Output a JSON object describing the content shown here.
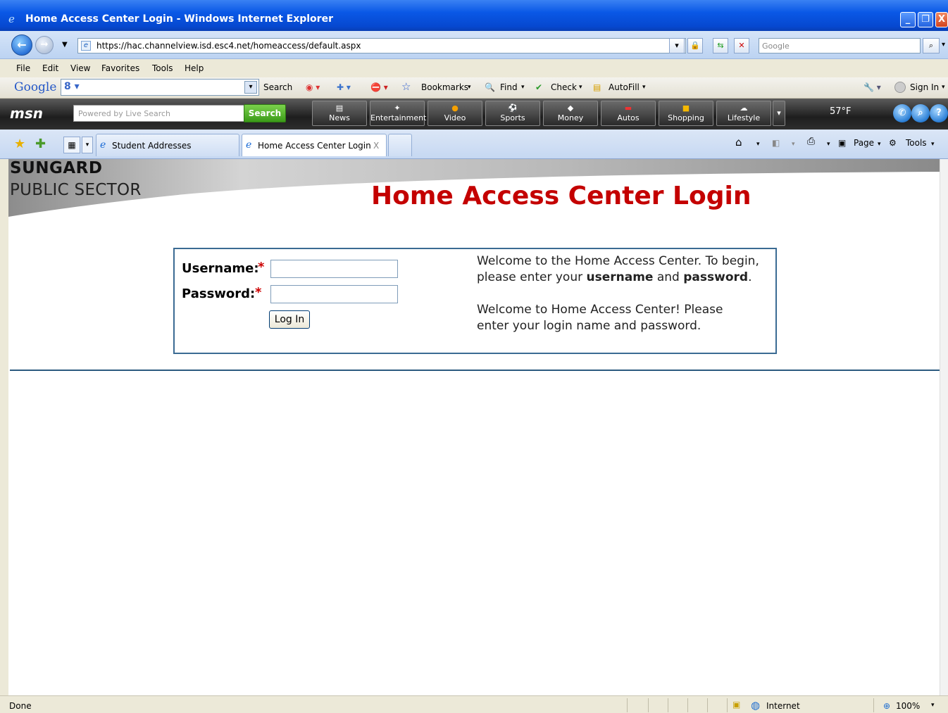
{
  "window": {
    "title": "Home Access Center Login - Windows Internet Explorer",
    "minimize": "_",
    "maximize": "❐",
    "close": "X"
  },
  "nav": {
    "back": "←",
    "forward": "→",
    "url": "https://hac.channelview.isd.esc4.net/homeaccess/default.aspx",
    "search_placeholder": "Google"
  },
  "menu": [
    "File",
    "Edit",
    "View",
    "Favorites",
    "Tools",
    "Help"
  ],
  "google_toolbar": {
    "logo": "Google",
    "search": "Search",
    "bookmarks": "Bookmarks",
    "find": "Find",
    "check": "Check",
    "autofill": "AutoFill",
    "sign_in": "Sign In"
  },
  "msn_toolbar": {
    "logo": "msn",
    "search_placeholder": "Powered by Live Search",
    "search_button": "Search",
    "tabs": [
      "News",
      "Entertainment",
      "Video",
      "Sports",
      "Money",
      "Autos",
      "Shopping",
      "Lifestyle"
    ],
    "weather": "57°F"
  },
  "tabs": {
    "items": [
      "Student Addresses",
      "Home Access Center Login"
    ],
    "close": "X"
  },
  "commands": {
    "page": "Page",
    "tools": "Tools"
  },
  "page": {
    "brand_line1": "SUNGARD",
    "brand_line2": "PUBLIC SECTOR",
    "title": "Home Access Center Login",
    "username_label": "Username:",
    "password_label": "Password:",
    "required_mark": "*",
    "login_button": "Log In",
    "welcome1_a": "Welcome to the Home Access Center. To begin, please enter your ",
    "welcome1_b": "username",
    "welcome1_c": " and ",
    "welcome1_d": "password",
    "welcome1_e": ".",
    "welcome2": "Welcome to Home Access Center! Please enter your login name and password."
  },
  "statusbar": {
    "status": "Done",
    "zone": "Internet",
    "zoom": "100%"
  }
}
